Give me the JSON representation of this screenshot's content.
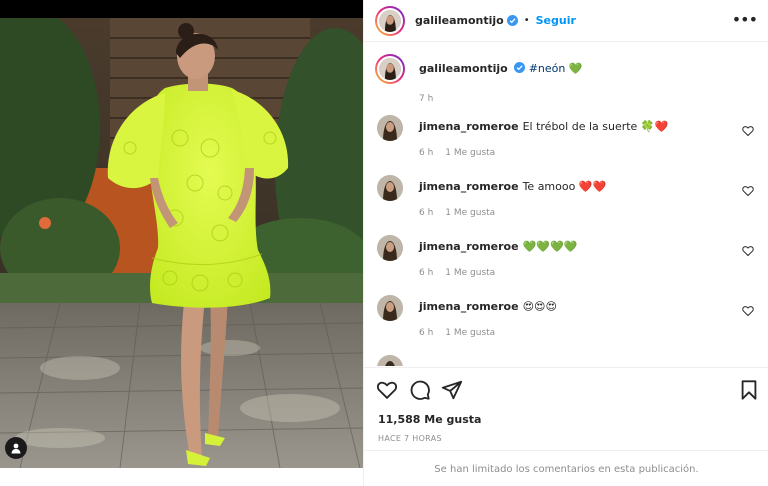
{
  "post": {
    "author": "galileamontijo",
    "follow_label": "Seguir",
    "separator": "•",
    "more_label": "•••"
  },
  "caption": {
    "username": "galileamontijo",
    "hashtag": "#neón",
    "emoji": "💚",
    "time": "7 h"
  },
  "comments": [
    {
      "username": "jimena_romeroe",
      "text": "El trébol de la suerte 🍀❤️",
      "time": "6 h",
      "likes": "1 Me gusta"
    },
    {
      "username": "jimena_romeroe",
      "text": "Te amooo ❤️❤️",
      "time": "6 h",
      "likes": "1 Me gusta"
    },
    {
      "username": "jimena_romeroe",
      "text": "💚💚💚💚",
      "time": "6 h",
      "likes": "1 Me gusta"
    },
    {
      "username": "jimena_romeroe",
      "text": "😍😍😍",
      "time": "6 h",
      "likes": "1 Me gusta"
    }
  ],
  "partial_comment": {
    "text": "..."
  },
  "stats": {
    "likes": "11,588 Me gusta",
    "posted": "HACE 7 HORAS"
  },
  "footer": {
    "limited_text": "Se han limitado los comentarios en esta publicación."
  },
  "icons": {
    "like": "heart-outline-icon",
    "comment": "comment-icon",
    "share": "paper-plane-icon",
    "save": "bookmark-icon",
    "tag": "user-tag-icon",
    "verified": "verified-badge-icon"
  },
  "colors": {
    "accent": "#0095f6",
    "hashtag": "#00376b",
    "muted": "#8e8e8e",
    "dress": "#d7f53a"
  }
}
